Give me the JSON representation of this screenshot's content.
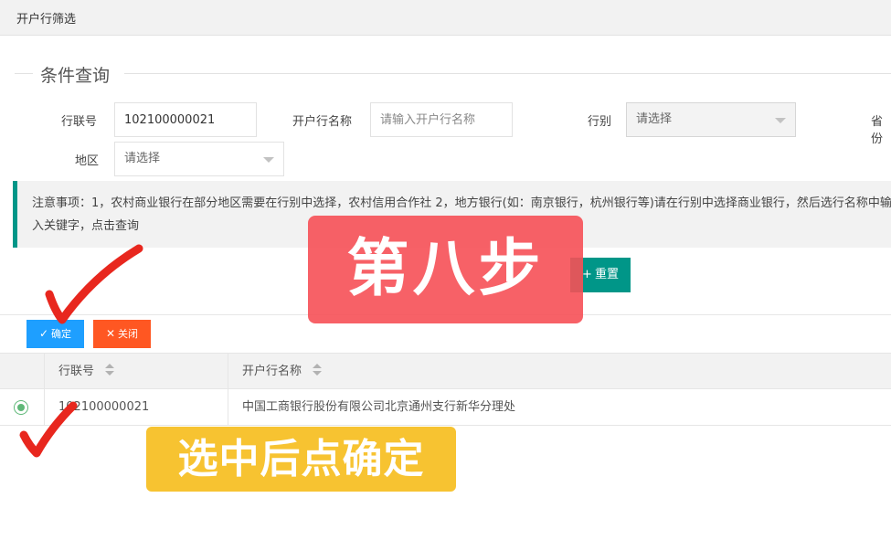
{
  "window": {
    "title": "开户行筛选"
  },
  "query": {
    "legend": "条件查询",
    "bank_no_label": "行联号",
    "bank_no_value": "102100000021",
    "bank_name_label": "开户行名称",
    "bank_name_placeholder": "请输入开户行名称",
    "bank_type_label": "行别",
    "bank_type_value": "请选择",
    "province_label": "省份",
    "region_label": "地区",
    "region_value": "请选择"
  },
  "notice": {
    "text": "注意事项：1，农村商业银行在部分地区需要在行别中选择，农村信用合作社 2，地方银行(如：南京银行，杭州银行等)请在行别中选择商业银行，然后选行名称中输入关键字，点击查询"
  },
  "actions": {
    "reset_label": "重置",
    "reset_icon": "plus-icon",
    "confirm_label": "确定",
    "confirm_icon": "check-icon",
    "close_label": "关闭",
    "close_icon": "close-icon"
  },
  "table": {
    "columns": [
      "行联号",
      "开户行名称"
    ],
    "rows": [
      {
        "selected": true,
        "bank_no": "102100000021",
        "bank_name": "中国工商银行股份有限公司北京通州支行新华分理处"
      }
    ]
  },
  "annotations": {
    "step": "第八步",
    "tip": "选中后点确定"
  },
  "colors": {
    "teal": "#009688",
    "blue": "#1e9fff",
    "orange": "#ff5722",
    "annotation_red": "#f65056",
    "annotation_yellow": "#f7c331",
    "check_stroke": "#e8271e"
  }
}
